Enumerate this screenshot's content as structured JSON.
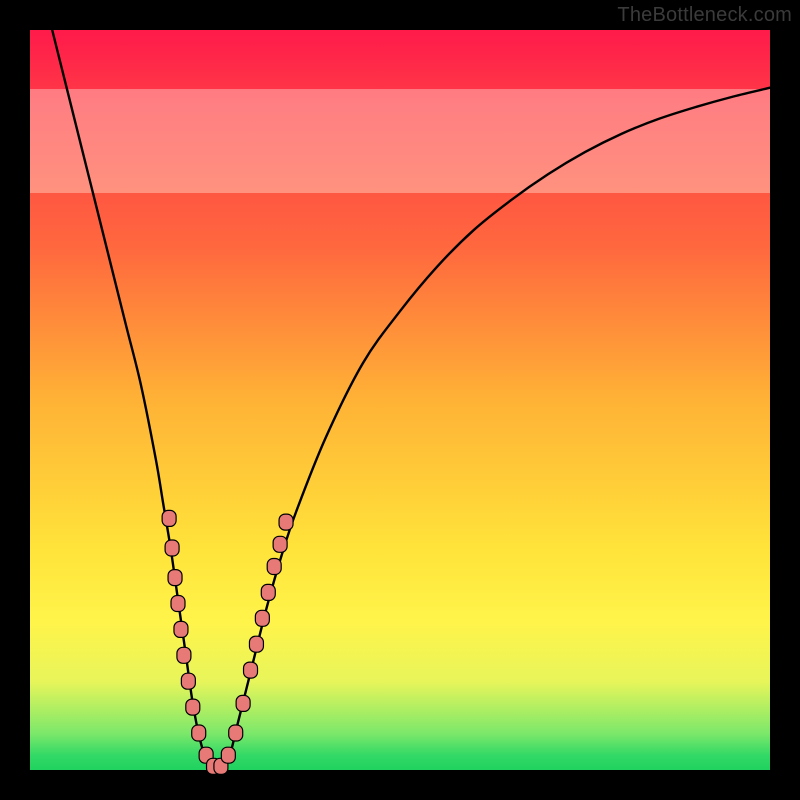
{
  "watermark": "TheBottleneck.com",
  "colors": {
    "frame": "#000000",
    "curve_stroke": "#000000",
    "marker_fill": "#e77a77",
    "marker_stroke": "#000000"
  },
  "chart_data": {
    "type": "line",
    "title": "",
    "xlabel": "",
    "ylabel": "",
    "xlim": [
      0,
      100
    ],
    "ylim": [
      0,
      100
    ],
    "grid": false,
    "legend": false,
    "series": [
      {
        "name": "bottleneck-curve",
        "x": [
          3,
          5,
          7,
          9,
          11,
          13,
          15,
          17,
          18,
          19,
          20,
          21,
          22,
          23,
          24,
          25,
          26,
          27,
          28,
          30,
          32,
          34,
          36,
          40,
          45,
          50,
          55,
          60,
          65,
          70,
          75,
          80,
          85,
          90,
          95,
          100
        ],
        "values": [
          100,
          92,
          84,
          76,
          68,
          60,
          52,
          42,
          36,
          30,
          23,
          16,
          9,
          4,
          1,
          0,
          0,
          2,
          6,
          14,
          22,
          29,
          35,
          45,
          55,
          62,
          68,
          73,
          77,
          80.5,
          83.5,
          86,
          88,
          89.6,
          91,
          92.2
        ]
      }
    ],
    "markers": [
      {
        "x": 18.8,
        "y": 34,
        "shape": "round"
      },
      {
        "x": 19.2,
        "y": 30,
        "shape": "round"
      },
      {
        "x": 19.6,
        "y": 26,
        "shape": "round"
      },
      {
        "x": 20.0,
        "y": 22.5,
        "shape": "round"
      },
      {
        "x": 20.4,
        "y": 19,
        "shape": "round"
      },
      {
        "x": 20.8,
        "y": 15.5,
        "shape": "round"
      },
      {
        "x": 21.4,
        "y": 12,
        "shape": "round"
      },
      {
        "x": 22.0,
        "y": 8.5,
        "shape": "round"
      },
      {
        "x": 22.8,
        "y": 5.0,
        "shape": "round"
      },
      {
        "x": 23.8,
        "y": 2.0,
        "shape": "round"
      },
      {
        "x": 24.8,
        "y": 0.5,
        "shape": "round"
      },
      {
        "x": 25.8,
        "y": 0.5,
        "shape": "round"
      },
      {
        "x": 26.8,
        "y": 2.0,
        "shape": "round"
      },
      {
        "x": 27.8,
        "y": 5.0,
        "shape": "round"
      },
      {
        "x": 28.8,
        "y": 9.0,
        "shape": "round"
      },
      {
        "x": 29.8,
        "y": 13.5,
        "shape": "round"
      },
      {
        "x": 30.6,
        "y": 17.0,
        "shape": "round"
      },
      {
        "x": 31.4,
        "y": 20.5,
        "shape": "round"
      },
      {
        "x": 32.2,
        "y": 24.0,
        "shape": "round"
      },
      {
        "x": 33.0,
        "y": 27.5,
        "shape": "round"
      },
      {
        "x": 33.8,
        "y": 30.5,
        "shape": "round"
      },
      {
        "x": 34.6,
        "y": 33.5,
        "shape": "round"
      }
    ],
    "pale_band_y": [
      78,
      92
    ]
  }
}
